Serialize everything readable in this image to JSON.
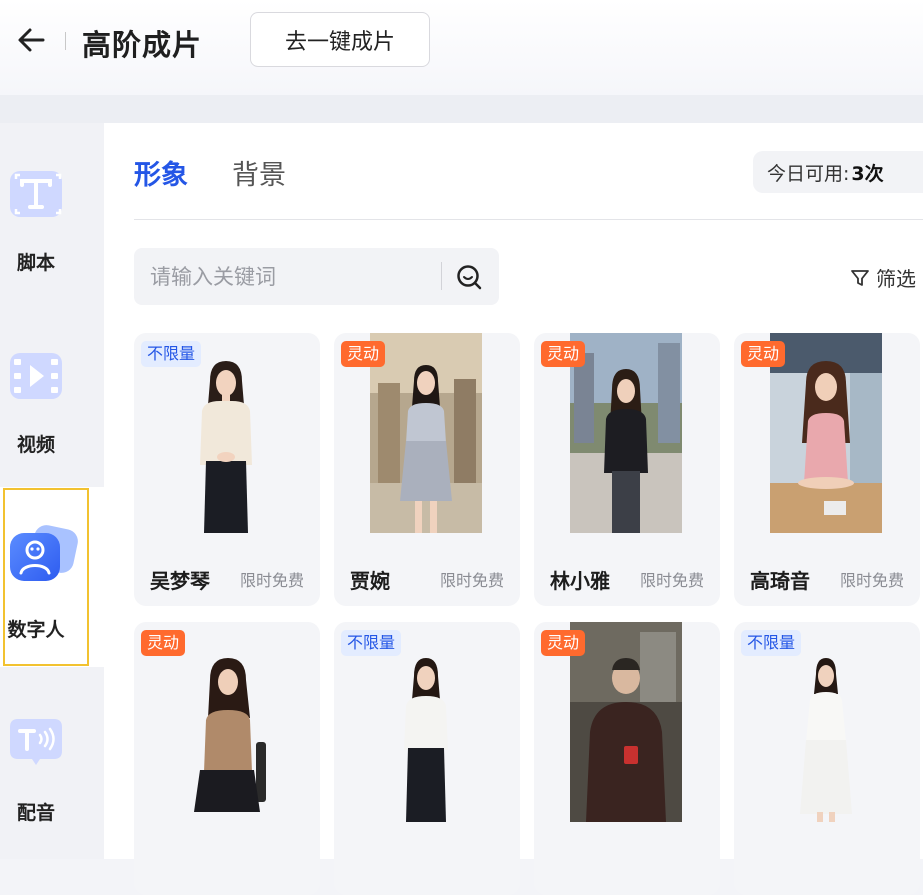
{
  "header": {
    "title": "高阶成片",
    "oneclick_label": "去一键成片"
  },
  "sidebar": {
    "items": [
      {
        "key": "script",
        "label": "脚本",
        "icon": "script-icon"
      },
      {
        "key": "video",
        "label": "视频",
        "icon": "video-icon"
      },
      {
        "key": "digital_human",
        "label": "数字人",
        "icon": "digital-human-icon",
        "active": true
      },
      {
        "key": "voice",
        "label": "配音",
        "icon": "voice-icon"
      }
    ]
  },
  "main": {
    "tabs": [
      {
        "label": "形象",
        "active": true
      },
      {
        "label": "背景",
        "active": false
      }
    ],
    "quota": {
      "label": "今日可用:",
      "value": "3次"
    },
    "search": {
      "placeholder": "请输入关键词"
    },
    "filter_label": "筛选",
    "cards": [
      {
        "badge": "不限量",
        "badge_color": "#2456e6",
        "name": "吴梦琴",
        "tag": "限时免费"
      },
      {
        "badge": "灵动",
        "badge_color": "#ff6a2e",
        "name": "贾婉",
        "tag": "限时免费"
      },
      {
        "badge": "灵动",
        "badge_color": "#ff6a2e",
        "name": "林小雅",
        "tag": "限时免费"
      },
      {
        "badge": "灵动",
        "badge_color": "#ff6a2e",
        "name": "高琦音",
        "tag": "限时免费"
      },
      {
        "badge": "灵动",
        "badge_color": "#ff6a2e",
        "name": "",
        "tag": ""
      },
      {
        "badge": "不限量",
        "badge_color": "#2456e6",
        "name": "",
        "tag": ""
      },
      {
        "badge": "灵动",
        "badge_color": "#ff6a2e",
        "name": "",
        "tag": ""
      },
      {
        "badge": "不限量",
        "badge_color": "#2456e6",
        "name": "",
        "tag": ""
      }
    ]
  },
  "colors": {
    "accent": "#2456e6",
    "badge_orange": "#ff6a2e",
    "highlight": "#f2c230"
  }
}
